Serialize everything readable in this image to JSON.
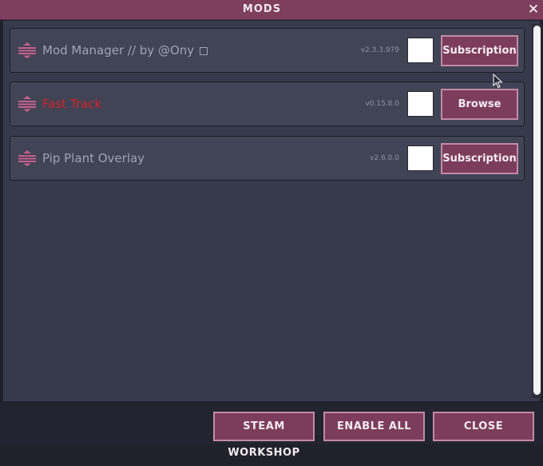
{
  "window": {
    "title": "MODS"
  },
  "mods": [
    {
      "name": "Mod Manager // by @Ony",
      "version": "v2.3.3.979",
      "button": "Subscription"
    },
    {
      "name": "Fast Track",
      "version": "v0.15.8.0",
      "button": "Browse"
    },
    {
      "name": "Pip Plant Overlay",
      "version": "v2.6.0.0",
      "button": "Subscription"
    }
  ],
  "footer": {
    "steam_workshop": "STEAM WORKSHOP",
    "enable_all": "ENABLE ALL",
    "close": "CLOSE"
  },
  "colors": {
    "accent": "#7c3d5c",
    "title_bar": "#7e3f5e",
    "error_name": "#d3202a"
  }
}
